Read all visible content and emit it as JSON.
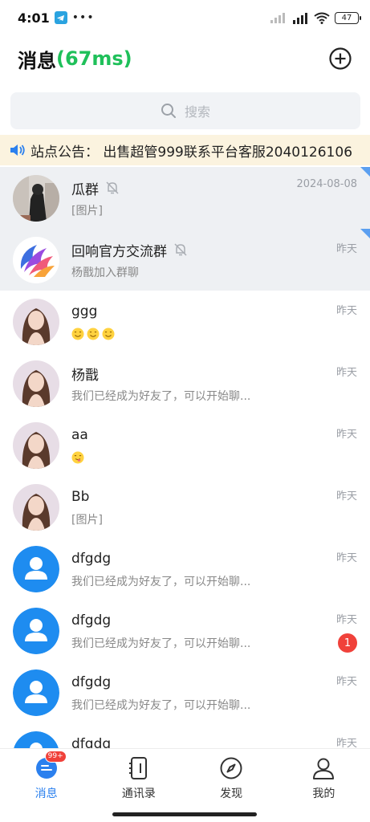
{
  "status_bar": {
    "time": "4:01",
    "dots": "•••",
    "battery": "47"
  },
  "header": {
    "title": "消息",
    "latency": "(67ms)"
  },
  "search": {
    "placeholder": "搜索"
  },
  "notice": {
    "text": "站点公告：  出售超管999联系平台客服2040126106"
  },
  "chats": [
    {
      "name": "瓜群",
      "preview": "[图片]",
      "time": "2024-08-08",
      "muted": true,
      "pinned": true,
      "avatar": "photo-dark"
    },
    {
      "name": "回响官方交流群",
      "preview": "杨戬加入群聊",
      "time": "昨天",
      "muted": true,
      "pinned": true,
      "avatar": "phoenix-logo"
    },
    {
      "name": "ggg",
      "preview": "",
      "emojis": 3,
      "time": "昨天",
      "avatar": "girl-photo"
    },
    {
      "name": "杨戬",
      "preview": "我们已经成为好友了，可以开始聊...",
      "time": "昨天",
      "avatar": "girl-photo"
    },
    {
      "name": "aa",
      "preview": "",
      "emojis": 1,
      "time": "昨天",
      "avatar": "girl-photo"
    },
    {
      "name": "Bb",
      "preview": "[图片]",
      "time": "昨天",
      "avatar": "girl-photo"
    },
    {
      "name": "dfgdg",
      "preview": "我们已经成为好友了，可以开始聊...",
      "time": "昨天",
      "avatar": "default-user"
    },
    {
      "name": "dfgdg",
      "preview": "我们已经成为好友了，可以开始聊...",
      "time": "昨天",
      "unread": "1",
      "avatar": "default-user"
    },
    {
      "name": "dfgdg",
      "preview": "我们已经成为好友了，可以开始聊...",
      "time": "昨天",
      "avatar": "default-user"
    },
    {
      "name": "dfgdg",
      "preview": "",
      "time": "昨天",
      "avatar": "default-user"
    }
  ],
  "tabs": [
    {
      "label": "消息",
      "active": true,
      "badge": "99+",
      "icon": "chat-bubble-icon"
    },
    {
      "label": "通讯录",
      "active": false,
      "icon": "contacts-book-icon"
    },
    {
      "label": "发现",
      "active": false,
      "icon": "compass-icon"
    },
    {
      "label": "我的",
      "active": false,
      "icon": "person-icon"
    }
  ],
  "colors": {
    "accent": "#2b80ee",
    "latency_green": "#1fc05a",
    "badge_red": "#f0413a",
    "notice_bg": "#fbf3df",
    "pinned_bg": "#eef0f3"
  }
}
